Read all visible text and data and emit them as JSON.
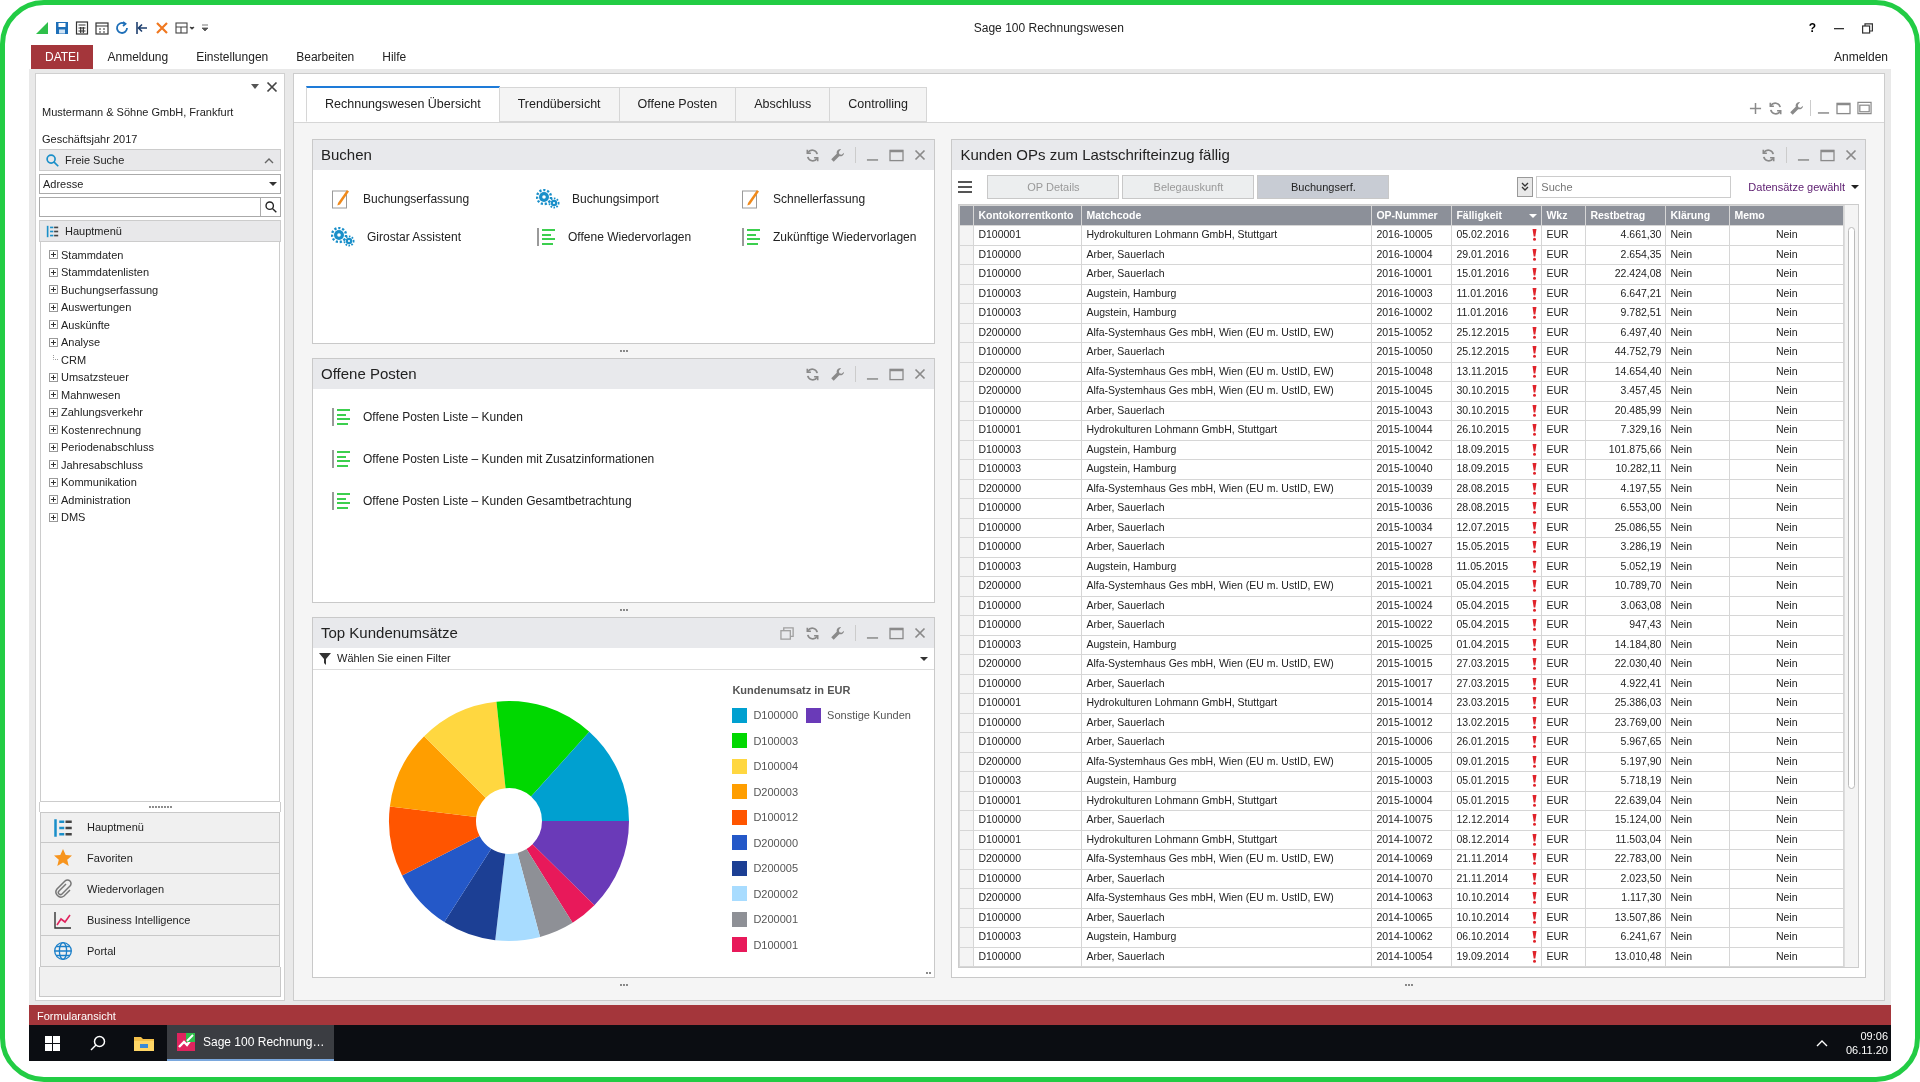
{
  "window": {
    "title": "Sage 100 Rechnungswesen",
    "help": "?",
    "login": "Anmelden"
  },
  "menu": [
    {
      "label": "DATEI",
      "kind": "file"
    },
    {
      "label": "Anmeldung",
      "kind": "item"
    },
    {
      "label": "Einstellungen",
      "kind": "item"
    },
    {
      "label": "Bearbeiten",
      "kind": "item"
    },
    {
      "label": "Hilfe",
      "kind": "item"
    }
  ],
  "sidebar": {
    "company": "Mustermann & Söhne GmbH, Frankfurt",
    "fiscal_year": "Geschäftsjahr 2017",
    "search_title": "Freie Suche",
    "search_scope": "Adresse",
    "tree_title": "Hauptmenü",
    "tree": [
      {
        "label": "Stammdaten",
        "kind": "folder"
      },
      {
        "label": "Stammdatenlisten",
        "kind": "folder"
      },
      {
        "label": "Buchungserfassung",
        "kind": "folder"
      },
      {
        "label": "Auswertungen",
        "kind": "folder"
      },
      {
        "label": "Auskünfte",
        "kind": "folder"
      },
      {
        "label": "Analyse",
        "kind": "folder"
      },
      {
        "label": "CRM",
        "kind": "leaf"
      },
      {
        "label": "Umsatzsteuer",
        "kind": "folder"
      },
      {
        "label": "Mahnwesen",
        "kind": "folder"
      },
      {
        "label": "Zahlungsverkehr",
        "kind": "folder"
      },
      {
        "label": "Kostenrechnung",
        "kind": "folder"
      },
      {
        "label": "Periodenabschluss",
        "kind": "folder"
      },
      {
        "label": "Jahresabschluss",
        "kind": "folder"
      },
      {
        "label": "Kommunikation",
        "kind": "folder"
      },
      {
        "label": "Administration",
        "kind": "folder"
      },
      {
        "label": "DMS",
        "kind": "folder"
      }
    ],
    "nav": [
      "Hauptmenü",
      "Favoriten",
      "Wiedervorlagen",
      "Business Intelligence",
      "Portal"
    ]
  },
  "tabs": [
    {
      "label": "Rechnungswesen Übersicht",
      "selected": true
    },
    {
      "label": "Trendübersicht",
      "selected": false
    },
    {
      "label": "Offene Posten",
      "selected": false
    },
    {
      "label": "Abschluss",
      "selected": false
    },
    {
      "label": "Controlling",
      "selected": false
    }
  ],
  "booking": {
    "title": "Buchen",
    "items": [
      "Buchungserfassung",
      "Buchungsimport",
      "Schnellerfassung",
      "Girostar Assistent",
      "Offene Wiedervorlagen",
      "Zukünftige Wiedervorlagen"
    ]
  },
  "open_items": {
    "title": "Offene Posten",
    "items": [
      "Offene Posten Liste – Kunden",
      "Offene Posten Liste – Kunden mit Zusatzinformationen",
      "Offene Posten Liste – Kunden Gesamtbetrachtung"
    ]
  },
  "top_sales": {
    "title": "Top Kundenumsätze",
    "filter": "Wählen Sie einen Filter",
    "legend_title": "Kundenumsatz in EUR",
    "legend": [
      {
        "label": "D100000",
        "color": "#00a0d0"
      },
      {
        "label": "Sonstige Kunden",
        "color": "#6a3ab8"
      },
      {
        "label": "D100003",
        "color": "#00d800"
      },
      {
        "label": "D100004",
        "color": "#ffd740"
      },
      {
        "label": "D200003",
        "color": "#ff9e00"
      },
      {
        "label": "D100012",
        "color": "#ff5500"
      },
      {
        "label": "D200000",
        "color": "#2458c8"
      },
      {
        "label": "D200005",
        "color": "#1c3f94"
      },
      {
        "label": "D200002",
        "color": "#a8dcff"
      },
      {
        "label": "D200001",
        "color": "#8e9096"
      },
      {
        "label": "D100001",
        "color": "#e8195a"
      }
    ]
  },
  "direct_debit": {
    "title": "Kunden OPs zum Lastschrifteinzug fällig",
    "buttons": [
      {
        "label": "OP Details",
        "disabled": true
      },
      {
        "label": "Belegauskunft",
        "disabled": true
      },
      {
        "label": "Buchungserf.",
        "disabled": false
      }
    ],
    "search_placeholder": "Suche",
    "selection": "Datensätze gewählt",
    "columns": [
      {
        "label": "Kontokorrentkonto",
        "sorted": false
      },
      {
        "label": "Matchcode",
        "sorted": false
      },
      {
        "label": "OP-Nummer",
        "sorted": false
      },
      {
        "label": "Fälligkeit",
        "sorted": true
      },
      {
        "label": "Wkz",
        "sorted": false
      },
      {
        "label": "Restbetrag",
        "sorted": false
      },
      {
        "label": "Klärung",
        "sorted": false
      },
      {
        "label": "Memo",
        "sorted": false
      }
    ],
    "rows": [
      {
        "account": "D100001",
        "matchcode": "Hydrokulturen Lohmann GmbH, Stuttgart",
        "op": "2016-10005",
        "due": "05.02.2016",
        "warning": true,
        "currency": "EUR",
        "amount": "4.661,30",
        "clearing": "Nein",
        "memo": "Nein"
      },
      {
        "account": "D100000",
        "matchcode": "Arber, Sauerlach",
        "op": "2016-10004",
        "due": "29.01.2016",
        "warning": true,
        "currency": "EUR",
        "amount": "2.654,35",
        "clearing": "Nein",
        "memo": "Nein"
      },
      {
        "account": "D100000",
        "matchcode": "Arber, Sauerlach",
        "op": "2016-10001",
        "due": "15.01.2016",
        "warning": true,
        "currency": "EUR",
        "amount": "22.424,08",
        "clearing": "Nein",
        "memo": "Nein"
      },
      {
        "account": "D100003",
        "matchcode": "Augstein, Hamburg",
        "op": "2016-10003",
        "due": "11.01.2016",
        "warning": true,
        "currency": "EUR",
        "amount": "6.647,21",
        "clearing": "Nein",
        "memo": "Nein"
      },
      {
        "account": "D100003",
        "matchcode": "Augstein, Hamburg",
        "op": "2016-10002",
        "due": "11.01.2016",
        "warning": true,
        "currency": "EUR",
        "amount": "9.782,51",
        "clearing": "Nein",
        "memo": "Nein"
      },
      {
        "account": "D200000",
        "matchcode": "Alfa-Systemhaus Ges mbH, Wien (EU m. UstID, EW)",
        "op": "2015-10052",
        "due": "25.12.2015",
        "warning": true,
        "currency": "EUR",
        "amount": "6.497,40",
        "clearing": "Nein",
        "memo": "Nein"
      },
      {
        "account": "D100000",
        "matchcode": "Arber, Sauerlach",
        "op": "2015-10050",
        "due": "25.12.2015",
        "warning": true,
        "currency": "EUR",
        "amount": "44.752,79",
        "clearing": "Nein",
        "memo": "Nein"
      },
      {
        "account": "D200000",
        "matchcode": "Alfa-Systemhaus Ges mbH, Wien (EU m. UstID, EW)",
        "op": "2015-10048",
        "due": "13.11.2015",
        "warning": true,
        "currency": "EUR",
        "amount": "14.654,40",
        "clearing": "Nein",
        "memo": "Nein"
      },
      {
        "account": "D200000",
        "matchcode": "Alfa-Systemhaus Ges mbH, Wien (EU m. UstID, EW)",
        "op": "2015-10045",
        "due": "30.10.2015",
        "warning": true,
        "currency": "EUR",
        "amount": "3.457,45",
        "clearing": "Nein",
        "memo": "Nein"
      },
      {
        "account": "D100000",
        "matchcode": "Arber, Sauerlach",
        "op": "2015-10043",
        "due": "30.10.2015",
        "warning": true,
        "currency": "EUR",
        "amount": "20.485,99",
        "clearing": "Nein",
        "memo": "Nein"
      },
      {
        "account": "D100001",
        "matchcode": "Hydrokulturen Lohmann GmbH, Stuttgart",
        "op": "2015-10044",
        "due": "26.10.2015",
        "warning": true,
        "currency": "EUR",
        "amount": "7.329,16",
        "clearing": "Nein",
        "memo": "Nein"
      },
      {
        "account": "D100003",
        "matchcode": "Augstein, Hamburg",
        "op": "2015-10042",
        "due": "18.09.2015",
        "warning": true,
        "currency": "EUR",
        "amount": "101.875,66",
        "clearing": "Nein",
        "memo": "Nein"
      },
      {
        "account": "D100003",
        "matchcode": "Augstein, Hamburg",
        "op": "2015-10040",
        "due": "18.09.2015",
        "warning": true,
        "currency": "EUR",
        "amount": "10.282,11",
        "clearing": "Nein",
        "memo": "Nein"
      },
      {
        "account": "D200000",
        "matchcode": "Alfa-Systemhaus Ges mbH, Wien (EU m. UstID, EW)",
        "op": "2015-10039",
        "due": "28.08.2015",
        "warning": true,
        "currency": "EUR",
        "amount": "4.197,55",
        "clearing": "Nein",
        "memo": "Nein"
      },
      {
        "account": "D100000",
        "matchcode": "Arber, Sauerlach",
        "op": "2015-10036",
        "due": "28.08.2015",
        "warning": true,
        "currency": "EUR",
        "amount": "6.553,00",
        "clearing": "Nein",
        "memo": "Nein"
      },
      {
        "account": "D100000",
        "matchcode": "Arber, Sauerlach",
        "op": "2015-10034",
        "due": "12.07.2015",
        "warning": true,
        "currency": "EUR",
        "amount": "25.086,55",
        "clearing": "Nein",
        "memo": "Nein"
      },
      {
        "account": "D100000",
        "matchcode": "Arber, Sauerlach",
        "op": "2015-10027",
        "due": "15.05.2015",
        "warning": true,
        "currency": "EUR",
        "amount": "3.286,19",
        "clearing": "Nein",
        "memo": "Nein"
      },
      {
        "account": "D100003",
        "matchcode": "Augstein, Hamburg",
        "op": "2015-10028",
        "due": "11.05.2015",
        "warning": true,
        "currency": "EUR",
        "amount": "5.052,19",
        "clearing": "Nein",
        "memo": "Nein"
      },
      {
        "account": "D200000",
        "matchcode": "Alfa-Systemhaus Ges mbH, Wien (EU m. UstID, EW)",
        "op": "2015-10021",
        "due": "05.04.2015",
        "warning": true,
        "currency": "EUR",
        "amount": "10.789,70",
        "clearing": "Nein",
        "memo": "Nein"
      },
      {
        "account": "D100000",
        "matchcode": "Arber, Sauerlach",
        "op": "2015-10024",
        "due": "05.04.2015",
        "warning": true,
        "currency": "EUR",
        "amount": "3.063,08",
        "clearing": "Nein",
        "memo": "Nein"
      },
      {
        "account": "D100000",
        "matchcode": "Arber, Sauerlach",
        "op": "2015-10022",
        "due": "05.04.2015",
        "warning": true,
        "currency": "EUR",
        "amount": "947,43",
        "clearing": "Nein",
        "memo": "Nein"
      },
      {
        "account": "D100003",
        "matchcode": "Augstein, Hamburg",
        "op": "2015-10025",
        "due": "01.04.2015",
        "warning": true,
        "currency": "EUR",
        "amount": "14.184,80",
        "clearing": "Nein",
        "memo": "Nein"
      },
      {
        "account": "D200000",
        "matchcode": "Alfa-Systemhaus Ges mbH, Wien (EU m. UstID, EW)",
        "op": "2015-10015",
        "due": "27.03.2015",
        "warning": true,
        "currency": "EUR",
        "amount": "22.030,40",
        "clearing": "Nein",
        "memo": "Nein"
      },
      {
        "account": "D100000",
        "matchcode": "Arber, Sauerlach",
        "op": "2015-10017",
        "due": "27.03.2015",
        "warning": true,
        "currency": "EUR",
        "amount": "4.922,41",
        "clearing": "Nein",
        "memo": "Nein"
      },
      {
        "account": "D100001",
        "matchcode": "Hydrokulturen Lohmann GmbH, Stuttgart",
        "op": "2015-10014",
        "due": "23.03.2015",
        "warning": true,
        "currency": "EUR",
        "amount": "25.386,03",
        "clearing": "Nein",
        "memo": "Nein"
      },
      {
        "account": "D100000",
        "matchcode": "Arber, Sauerlach",
        "op": "2015-10012",
        "due": "13.02.2015",
        "warning": true,
        "currency": "EUR",
        "amount": "23.769,00",
        "clearing": "Nein",
        "memo": "Nein"
      },
      {
        "account": "D100000",
        "matchcode": "Arber, Sauerlach",
        "op": "2015-10006",
        "due": "26.01.2015",
        "warning": true,
        "currency": "EUR",
        "amount": "5.967,65",
        "clearing": "Nein",
        "memo": "Nein"
      },
      {
        "account": "D200000",
        "matchcode": "Alfa-Systemhaus Ges mbH, Wien (EU m. UstID, EW)",
        "op": "2015-10005",
        "due": "09.01.2015",
        "warning": true,
        "currency": "EUR",
        "amount": "5.197,90",
        "clearing": "Nein",
        "memo": "Nein"
      },
      {
        "account": "D100003",
        "matchcode": "Augstein, Hamburg",
        "op": "2015-10003",
        "due": "05.01.2015",
        "warning": true,
        "currency": "EUR",
        "amount": "5.718,19",
        "clearing": "Nein",
        "memo": "Nein"
      },
      {
        "account": "D100001",
        "matchcode": "Hydrokulturen Lohmann GmbH, Stuttgart",
        "op": "2015-10004",
        "due": "05.01.2015",
        "warning": true,
        "currency": "EUR",
        "amount": "22.639,04",
        "clearing": "Nein",
        "memo": "Nein"
      },
      {
        "account": "D100000",
        "matchcode": "Arber, Sauerlach",
        "op": "2014-10075",
        "due": "12.12.2014",
        "warning": true,
        "currency": "EUR",
        "amount": "15.124,00",
        "clearing": "Nein",
        "memo": "Nein"
      },
      {
        "account": "D100001",
        "matchcode": "Hydrokulturen Lohmann GmbH, Stuttgart",
        "op": "2014-10072",
        "due": "08.12.2014",
        "warning": true,
        "currency": "EUR",
        "amount": "11.503,04",
        "clearing": "Nein",
        "memo": "Nein"
      },
      {
        "account": "D200000",
        "matchcode": "Alfa-Systemhaus Ges mbH, Wien (EU m. UstID, EW)",
        "op": "2014-10069",
        "due": "21.11.2014",
        "warning": true,
        "currency": "EUR",
        "amount": "22.783,00",
        "clearing": "Nein",
        "memo": "Nein"
      },
      {
        "account": "D100000",
        "matchcode": "Arber, Sauerlach",
        "op": "2014-10070",
        "due": "21.11.2014",
        "warning": true,
        "currency": "EUR",
        "amount": "2.023,50",
        "clearing": "Nein",
        "memo": "Nein"
      },
      {
        "account": "D200000",
        "matchcode": "Alfa-Systemhaus Ges mbH, Wien (EU m. UstID, EW)",
        "op": "2014-10063",
        "due": "10.10.2014",
        "warning": true,
        "currency": "EUR",
        "amount": "1.117,30",
        "clearing": "Nein",
        "memo": "Nein"
      },
      {
        "account": "D100000",
        "matchcode": "Arber, Sauerlach",
        "op": "2014-10065",
        "due": "10.10.2014",
        "warning": true,
        "currency": "EUR",
        "amount": "13.507,86",
        "clearing": "Nein",
        "memo": "Nein"
      },
      {
        "account": "D100003",
        "matchcode": "Augstein, Hamburg",
        "op": "2014-10062",
        "due": "06.10.2014",
        "warning": true,
        "currency": "EUR",
        "amount": "6.241,67",
        "clearing": "Nein",
        "memo": "Nein"
      },
      {
        "account": "D100000",
        "matchcode": "Arber, Sauerlach",
        "op": "2014-10054",
        "due": "19.09.2014",
        "warning": true,
        "currency": "EUR",
        "amount": "13.010,48",
        "clearing": "Nein",
        "memo": "Nein"
      }
    ]
  },
  "status_bar": "Formularansicht",
  "taskbar": {
    "app": "Sage 100 Rechnung…",
    "time": "09:06",
    "date": "06.11.20"
  }
}
